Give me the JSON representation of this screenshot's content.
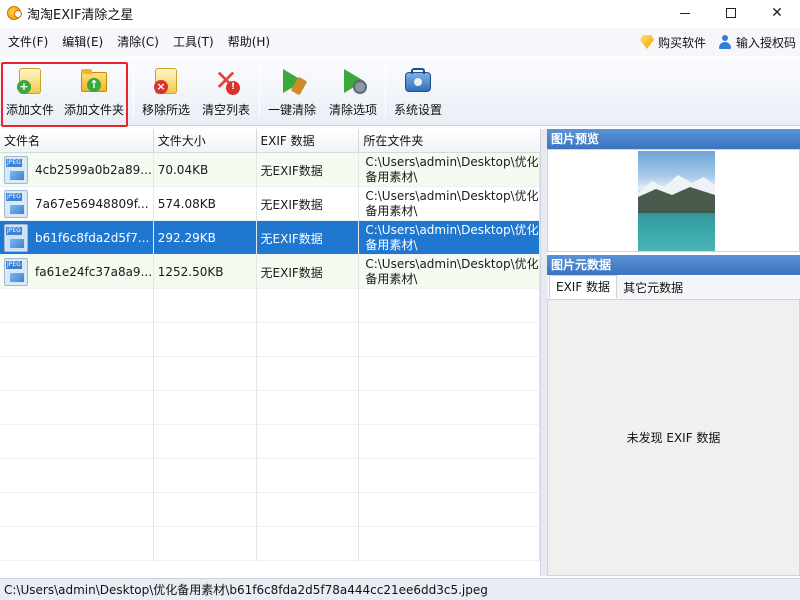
{
  "window": {
    "title": "淘淘EXIF清除之星"
  },
  "menu": {
    "items": [
      "文件(F)",
      "编辑(E)",
      "清除(C)",
      "工具(T)",
      "帮助(H)"
    ],
    "buy_label": "购买软件",
    "auth_label": "输入授权码"
  },
  "toolbar": {
    "add_file": "添加文件",
    "add_folder": "添加文件夹",
    "remove_selected": "移除所选",
    "clear_list": "清空列表",
    "one_click_clean": "一键清除",
    "clean_options": "清除选项",
    "system_settings": "系统设置"
  },
  "table": {
    "headers": [
      "文件名",
      "文件大小",
      "EXIF 数据",
      "所在文件夹"
    ],
    "rows": [
      {
        "name": "4cb2599a0b2a89...",
        "size": "70.04KB",
        "exif": "无EXIF数据",
        "path1": "C:\\Users\\admin\\Desktop\\优化",
        "path2": "备用素材\\"
      },
      {
        "name": "7a67e56948809f...",
        "size": "574.08KB",
        "exif": "无EXIF数据",
        "path1": "C:\\Users\\admin\\Desktop\\优化",
        "path2": "备用素材\\"
      },
      {
        "name": "b61f6c8fda2d5f7...",
        "size": "292.29KB",
        "exif": "无EXIF数据",
        "path1": "C:\\Users\\admin\\Desktop\\优化",
        "path2": "备用素材\\"
      },
      {
        "name": "fa61e24fc37a8a9...",
        "size": "1252.50KB",
        "exif": "无EXIF数据",
        "path1": "C:\\Users\\admin\\Desktop\\优化",
        "path2": "备用素材\\"
      }
    ],
    "selected_index": 2,
    "file_type_tag": "JPEG"
  },
  "preview": {
    "title": "图片预览"
  },
  "metadata": {
    "title": "图片元数据",
    "tabs": [
      "EXIF 数据",
      "其它元数据"
    ],
    "empty_message": "未发现 EXIF 数据"
  },
  "statusbar": {
    "path": "C:\\Users\\admin\\Desktop\\优化备用素材\\b61f6c8fda2d5f78a444cc21ee6dd3c5.jpeg"
  },
  "colors": {
    "accent": "#1f77d0",
    "panel_title": "#3a74c0",
    "highlight": "#e8232a"
  }
}
